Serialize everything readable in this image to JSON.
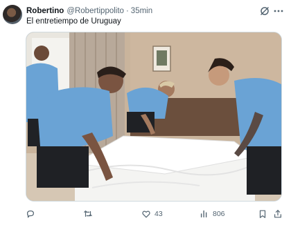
{
  "tweet": {
    "author_name": "Robertino",
    "author_handle": "@Robertippolito",
    "separator": "·",
    "time": "35min",
    "text": "El entretiempo de Uruguay",
    "image_alt": "Jugadores de Uruguay haciendo una cama en una habitación de hotel"
  },
  "actions": {
    "reply_count": "",
    "retweet_count": "",
    "like_count": "43",
    "views_count": "806"
  },
  "colors": {
    "text_primary": "#0f1419",
    "text_secondary": "#536471",
    "border": "#cfd9de",
    "jersey": "#6aa3d5"
  },
  "icons": [
    "avatar",
    "grok-icon",
    "more-icon",
    "reply-icon",
    "retweet-icon",
    "like-icon",
    "views-icon",
    "bookmark-icon",
    "share-icon"
  ]
}
